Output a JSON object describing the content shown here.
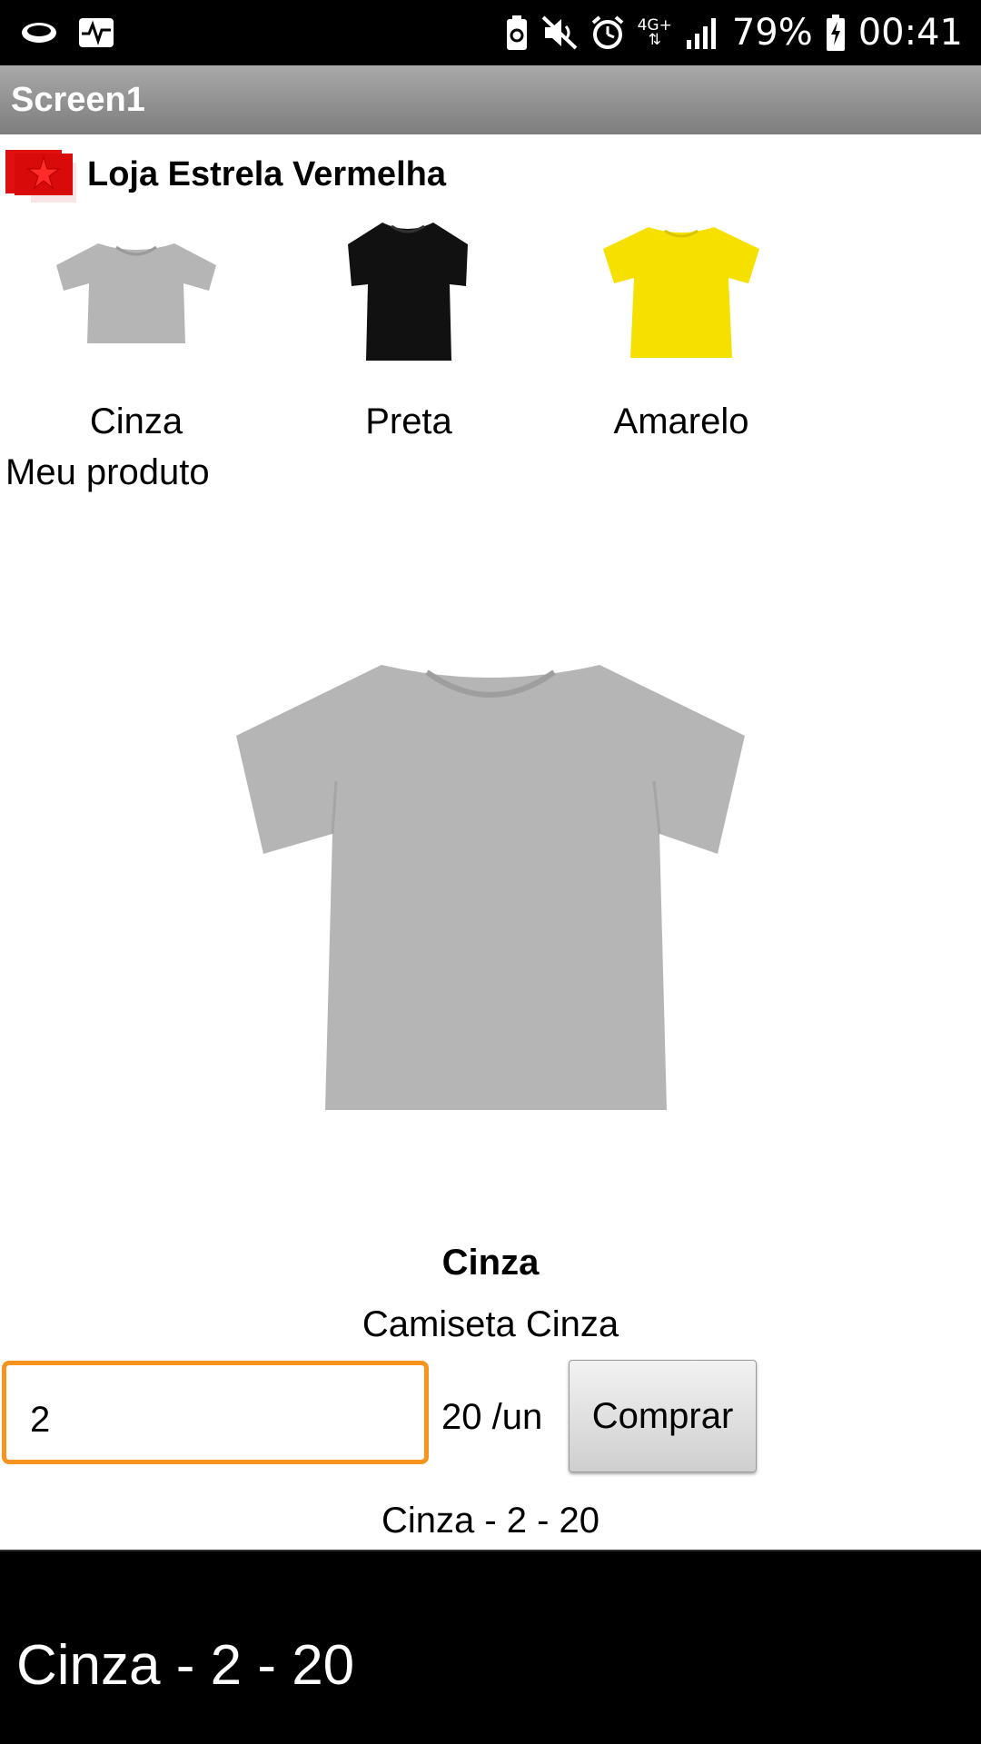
{
  "status_bar": {
    "battery_percent": "79%",
    "time": "00:41",
    "network": "4G+",
    "icons": [
      "cloud-icon",
      "activity-icon",
      "battery-saver-icon",
      "mute-icon",
      "alarm-icon",
      "network-icon",
      "signal-icon",
      "battery-icon"
    ]
  },
  "app": {
    "title": "Screen1"
  },
  "store": {
    "name": "Loja Estrela Vermelha",
    "logo_color": "#e01010"
  },
  "products": [
    {
      "label": "Cinza",
      "color": "#b5b5b5"
    },
    {
      "label": "Preta",
      "color": "#111111"
    },
    {
      "label": "Amarelo",
      "color": "#f5e000"
    }
  ],
  "section": {
    "label": "Meu produto"
  },
  "selected_product": {
    "title": "Cinza",
    "description": "Camiseta Cinza",
    "quantity": "2",
    "price": "20 /un",
    "buy_label": "Comprar",
    "summary": "Cinza - 2 - 20"
  },
  "toast": {
    "message": "Cinza - 2 - 20"
  }
}
